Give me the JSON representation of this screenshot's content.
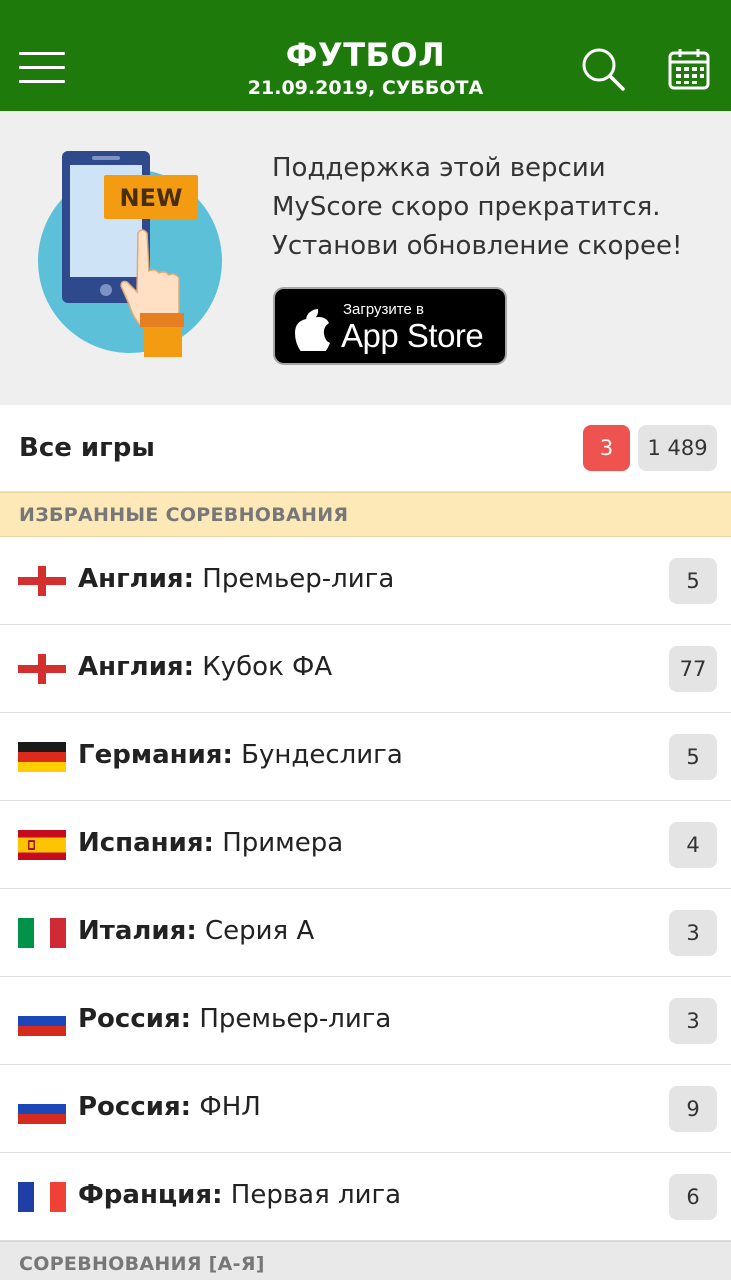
{
  "header": {
    "title": "ФУТБОЛ",
    "date": "21.09.2019, СУББОТА",
    "bg_color": "#1f7a0c"
  },
  "promo": {
    "badge_text": "NEW",
    "line1": "Поддержка этой версии",
    "line2": "MyScore скоро прекратится.",
    "line3": "Установи обновление скорее!",
    "store_small": "Загрузите в",
    "store_big": "App Store"
  },
  "all_games": {
    "label": "Все игры",
    "live_count": "3",
    "total_count": "1 489",
    "live_color": "#ef5350"
  },
  "sections": {
    "favorites": "ИЗБРАННЫЕ СОРЕВНОВАНИЯ",
    "all": "СОРЕВНОВАНИЯ [А-Я]"
  },
  "leagues": [
    {
      "country": "Англия:",
      "league": "Премьер-лига",
      "count": "5",
      "flag": "england"
    },
    {
      "country": "Англия:",
      "league": "Кубок ФА",
      "count": "77",
      "flag": "england"
    },
    {
      "country": "Германия:",
      "league": "Бундеслига",
      "count": "5",
      "flag": "germany"
    },
    {
      "country": "Испания:",
      "league": "Примера",
      "count": "4",
      "flag": "spain"
    },
    {
      "country": "Италия:",
      "league": "Серия А",
      "count": "3",
      "flag": "italy"
    },
    {
      "country": "Россия:",
      "league": "Премьер-лига",
      "count": "3",
      "flag": "russia"
    },
    {
      "country": "Россия:",
      "league": "ФНЛ",
      "count": "9",
      "flag": "russia"
    },
    {
      "country": "Франция:",
      "league": "Первая лига",
      "count": "6",
      "flag": "france"
    }
  ]
}
